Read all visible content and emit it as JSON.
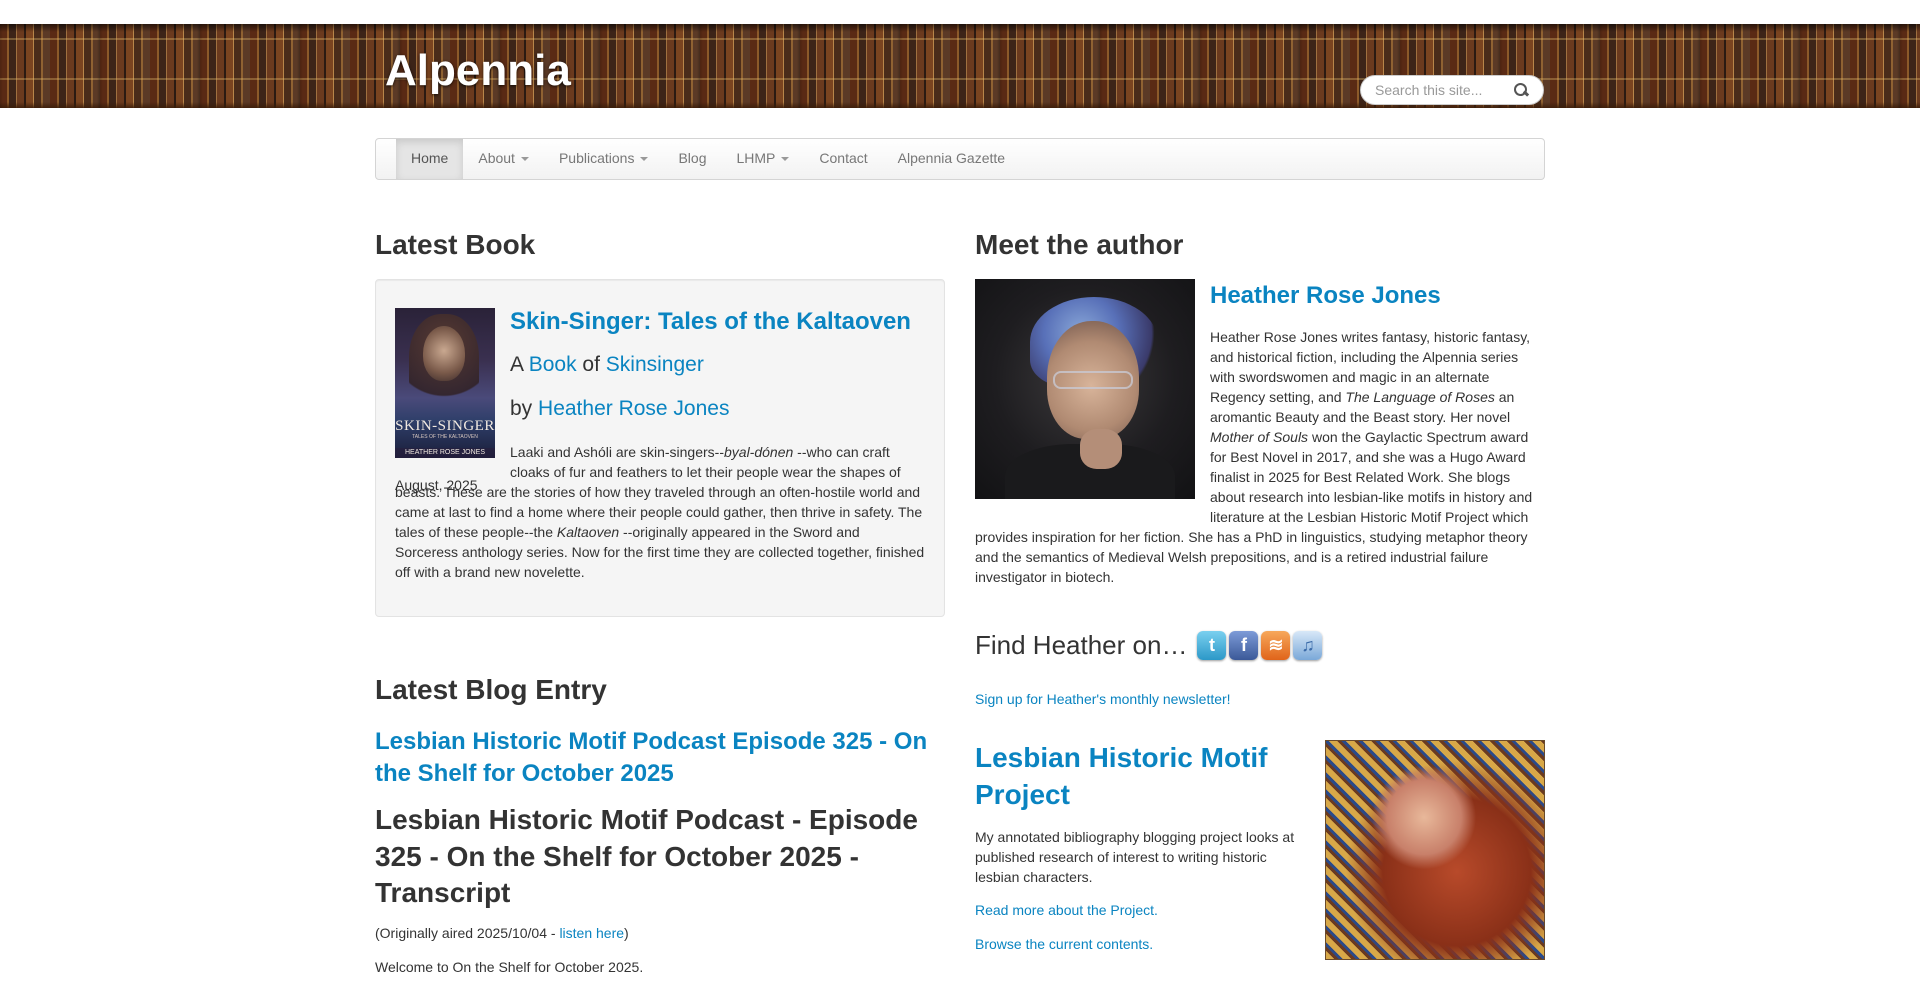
{
  "header": {
    "site_name": "Alpennia",
    "search_placeholder": "Search this site..."
  },
  "nav": {
    "items": [
      {
        "label": "Home",
        "active": true
      },
      {
        "label": "About",
        "dropdown": true
      },
      {
        "label": "Publications",
        "dropdown": true
      },
      {
        "label": "Blog"
      },
      {
        "label": "LHMP",
        "dropdown": true
      },
      {
        "label": "Contact"
      },
      {
        "label": "Alpennia Gazette"
      }
    ]
  },
  "latest_book": {
    "heading": "Latest Book",
    "cover": {
      "title": "SKIN-SINGER",
      "subtitle": "TALES OF THE KALTAOVEN",
      "author": "HEATHER ROSE JONES"
    },
    "title": "Skin-Singer: Tales of the Kaltaoven",
    "meta_a": "A",
    "meta_book": "Book",
    "meta_of": "of",
    "meta_series": "Skinsinger",
    "by": "by",
    "author": "Heather Rose Jones",
    "date": "August, 2025",
    "desc_1": "Laaki and Ashóli are skin-singers--",
    "desc_italic_1": "byal-dónen",
    "desc_2": " --who can craft cloaks of fur and feathers to let their people wear the shapes of beasts. These are the stories of how they traveled through an often-hostile world and came at last to find a home where their people could gather, then thrive in safety. The tales of these people--the ",
    "desc_italic_2": "Kaltaoven",
    "desc_3": " --originally appeared in the Sword and Sorceress anthology series. Now for the first time they are collected together, finished off with a brand new novelette."
  },
  "latest_blog": {
    "heading": "Latest Blog Entry",
    "title": "Lesbian Historic Motif Podcast Episode 325 - On the Shelf for October 2025",
    "subheading": "Lesbian Historic Motif Podcast - Episode 325 - On the Shelf for October 2025 - Transcript",
    "aired_prefix": "(Originally aired 2025/10/04 - ",
    "aired_link": "listen here",
    "aired_suffix": ")",
    "welcome": "Welcome to On the Shelf for October 2025."
  },
  "author": {
    "heading": "Meet the author",
    "name": "Heather Rose Jones",
    "bio_1": "Heather Rose Jones writes fantasy, historic fantasy, and historical fiction, including the Alpennia series with swordswomen and magic in an alternate Regency setting, and ",
    "bio_italic_1": "The Language of Roses",
    "bio_2": "  an aromantic Beauty and the Beast story. Her novel ",
    "bio_italic_2": "Mother of Souls",
    "bio_3": "  won the Gaylactic Spectrum award for Best Novel in 2017, and she was a Hugo Award finalist in 2025 for Best Related Work. She blogs about research into lesbian-like motifs in history and literature at the Lesbian Historic Motif Project which provides inspiration for her fiction. She has a PhD in linguistics, studying metaphor theory and the semantics of Medieval Welsh prepositions, and is a retired industrial failure investigator in biotech."
  },
  "social": {
    "find_text": "Find Heather on…",
    "icons": [
      {
        "name": "twitter-icon",
        "glyph": "t"
      },
      {
        "name": "facebook-icon",
        "glyph": "f"
      },
      {
        "name": "rss-icon",
        "glyph": "≋"
      },
      {
        "name": "itunes-icon",
        "glyph": "♫"
      }
    ],
    "newsletter": "Sign up for Heather's monthly newsletter!"
  },
  "lhmp": {
    "title": "Lesbian Historic Motif Project",
    "desc": "My annotated bibliography blogging project looks at published research of interest to writing historic lesbian characters.",
    "read_more": "Read more about the Project.",
    "browse": "Browse the current contents."
  },
  "colors": {
    "link": "#0a84c1",
    "text": "#333333"
  }
}
